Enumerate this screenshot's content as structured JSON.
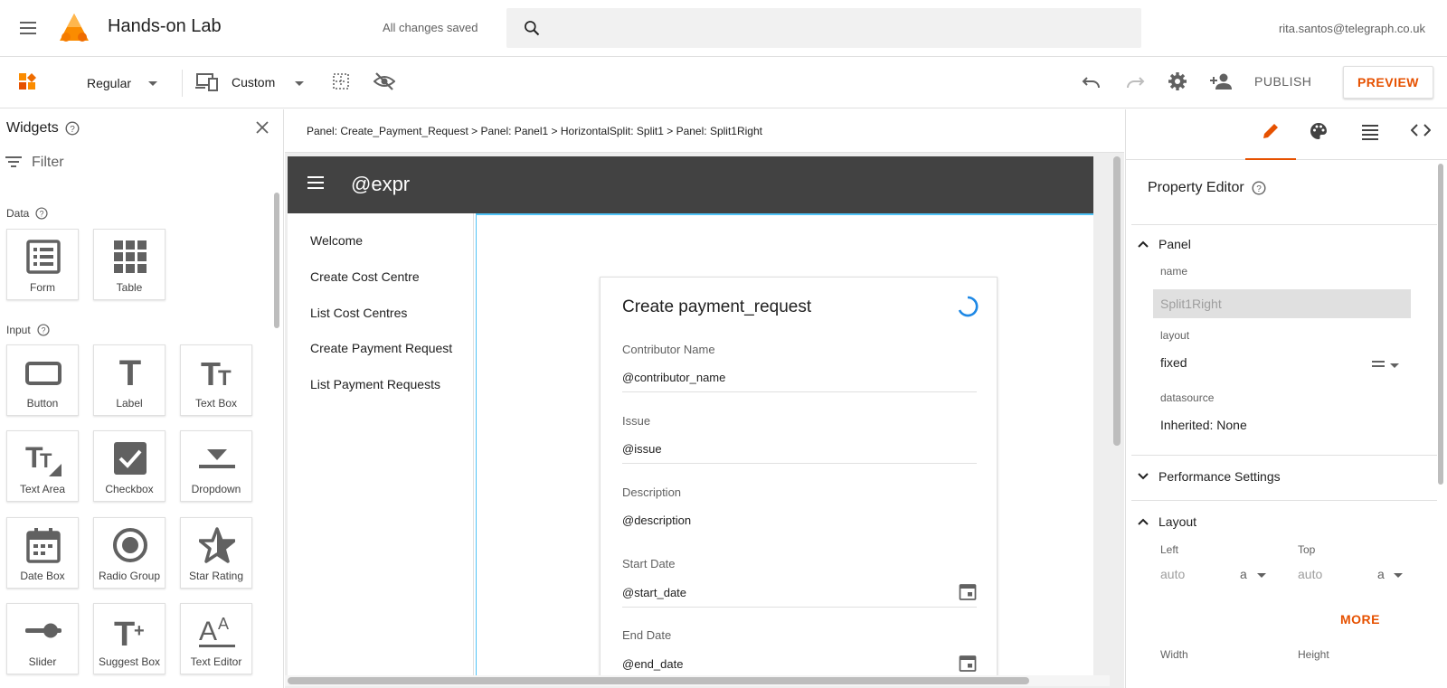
{
  "header": {
    "app_title": "Hands-on Lab",
    "save_status": "All changes saved",
    "search_placeholder": "",
    "user_email": "rita.santos@telegraph.co.uk",
    "accent_color": "#e65100"
  },
  "toolbar": {
    "style_select": "Regular",
    "device_select": "Custom",
    "publish_label": "PUBLISH",
    "preview_label": "PREVIEW"
  },
  "widgets": {
    "title": "Widgets",
    "filter_label": "Filter",
    "sections": [
      {
        "label": "Data",
        "items": [
          "Form",
          "Table"
        ]
      },
      {
        "label": "Input",
        "items": [
          "Button",
          "Label",
          "Text Box",
          "Text Area",
          "Checkbox",
          "Dropdown",
          "Date Box",
          "Radio Group",
          "Star Rating",
          "Slider",
          "Suggest Box",
          "Text Editor"
        ]
      }
    ]
  },
  "canvas": {
    "breadcrumb": "Panel: Create_Payment_Request > Panel: Panel1 > HorizontalSplit: Split1 > Panel: Split1Right",
    "app_bar_title": "@expr",
    "nav_items": [
      "Welcome",
      "Create Cost Centre",
      "List Cost Centres",
      "Create Payment Request",
      "List Payment Requests"
    ],
    "form": {
      "title": "Create payment_request",
      "fields": [
        {
          "label": "Contributor Name",
          "value": "@contributor_name"
        },
        {
          "label": "Issue",
          "value": "@issue"
        },
        {
          "label": "Description",
          "value": "@description"
        },
        {
          "label": "Start Date",
          "value": "@start_date"
        },
        {
          "label": "End Date",
          "value": "@end_date"
        }
      ]
    }
  },
  "property_editor": {
    "title": "Property Editor",
    "panel_section": "Panel",
    "name_label": "name",
    "name_value": "Split1Right",
    "layout_label": "layout",
    "layout_value": "fixed",
    "datasource_label": "datasource",
    "datasource_value": "Inherited: None",
    "performance_section": "Performance Settings",
    "layout_section": "Layout",
    "left_label": "Left",
    "left_value": "auto",
    "left_unit": "a",
    "top_label": "Top",
    "top_value": "auto",
    "top_unit": "a",
    "more_label": "MORE",
    "width_label": "Width",
    "height_label": "Height"
  }
}
